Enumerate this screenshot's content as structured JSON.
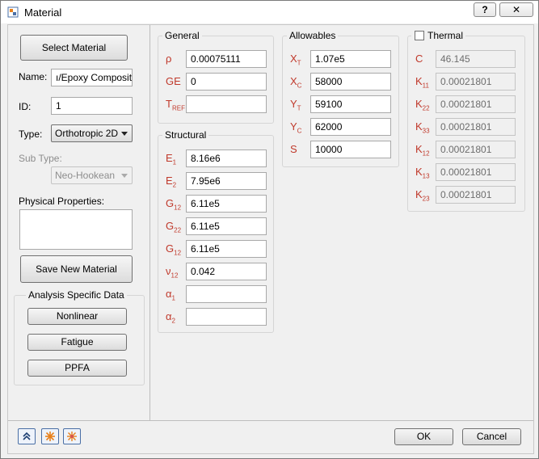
{
  "window": {
    "title": "Material",
    "help_label": "?",
    "close_label": "✕"
  },
  "left": {
    "select_material": "Select Material",
    "name_label": "Name:",
    "name_value": "ı/Epoxy Composite",
    "id_label": "ID:",
    "id_value": "1",
    "type_label": "Type:",
    "type_value": "Orthotropic 2D",
    "subtype_label": "Sub Type:",
    "subtype_value": "Neo-Hookean",
    "physical_label": "Physical Properties:",
    "save_new": "Save New Material",
    "analysis_group": "Analysis Specific Data",
    "nonlinear": "Nonlinear",
    "fatigue": "Fatigue",
    "ppfa": "PPFA"
  },
  "general": {
    "title": "General",
    "rows": [
      {
        "sym": "ρ",
        "sub": "",
        "value": "0.00075111"
      },
      {
        "sym": "GE",
        "sub": "",
        "value": "0"
      },
      {
        "sym": "T",
        "sub": "REF",
        "value": ""
      }
    ]
  },
  "structural": {
    "title": "Structural",
    "rows": [
      {
        "sym": "E",
        "sub": "1",
        "value": "8.16e6"
      },
      {
        "sym": "E",
        "sub": "2",
        "value": "7.95e6"
      },
      {
        "sym": "G",
        "sub": "12",
        "value": "6.11e5"
      },
      {
        "sym": "G",
        "sub": "22",
        "value": "6.11e5"
      },
      {
        "sym": "G",
        "sub": "12",
        "value": "6.11e5"
      },
      {
        "sym": "ν",
        "sub": "12",
        "value": "0.042"
      },
      {
        "sym": "α",
        "sub": "1",
        "value": ""
      },
      {
        "sym": "α",
        "sub": "2",
        "value": ""
      }
    ]
  },
  "allowables": {
    "title": "Allowables",
    "rows": [
      {
        "sym": "X",
        "sub": "T",
        "value": "1.07e5"
      },
      {
        "sym": "X",
        "sub": "C",
        "value": "58000"
      },
      {
        "sym": "Y",
        "sub": "T",
        "value": "59100"
      },
      {
        "sym": "Y",
        "sub": "C",
        "value": "62000"
      },
      {
        "sym": "S",
        "sub": "",
        "value": "10000"
      }
    ]
  },
  "thermal": {
    "title": "Thermal",
    "checked": false,
    "rows": [
      {
        "sym": "C",
        "sub": "",
        "value": "46.145"
      },
      {
        "sym": "K",
        "sub": "11",
        "value": "0.00021801"
      },
      {
        "sym": "K",
        "sub": "22",
        "value": "0.00021801"
      },
      {
        "sym": "K",
        "sub": "33",
        "value": "0.00021801"
      },
      {
        "sym": "K",
        "sub": "12",
        "value": "0.00021801"
      },
      {
        "sym": "K",
        "sub": "13",
        "value": "0.00021801"
      },
      {
        "sym": "K",
        "sub": "23",
        "value": "0.00021801"
      }
    ]
  },
  "footer": {
    "icons": [
      "double-chevron-up-icon",
      "star-burst-icon",
      "star-burst-icon"
    ],
    "ok": "OK",
    "cancel": "Cancel"
  },
  "colors": {
    "symbol": "#c0392b",
    "accent_orange": "#e8801a"
  }
}
